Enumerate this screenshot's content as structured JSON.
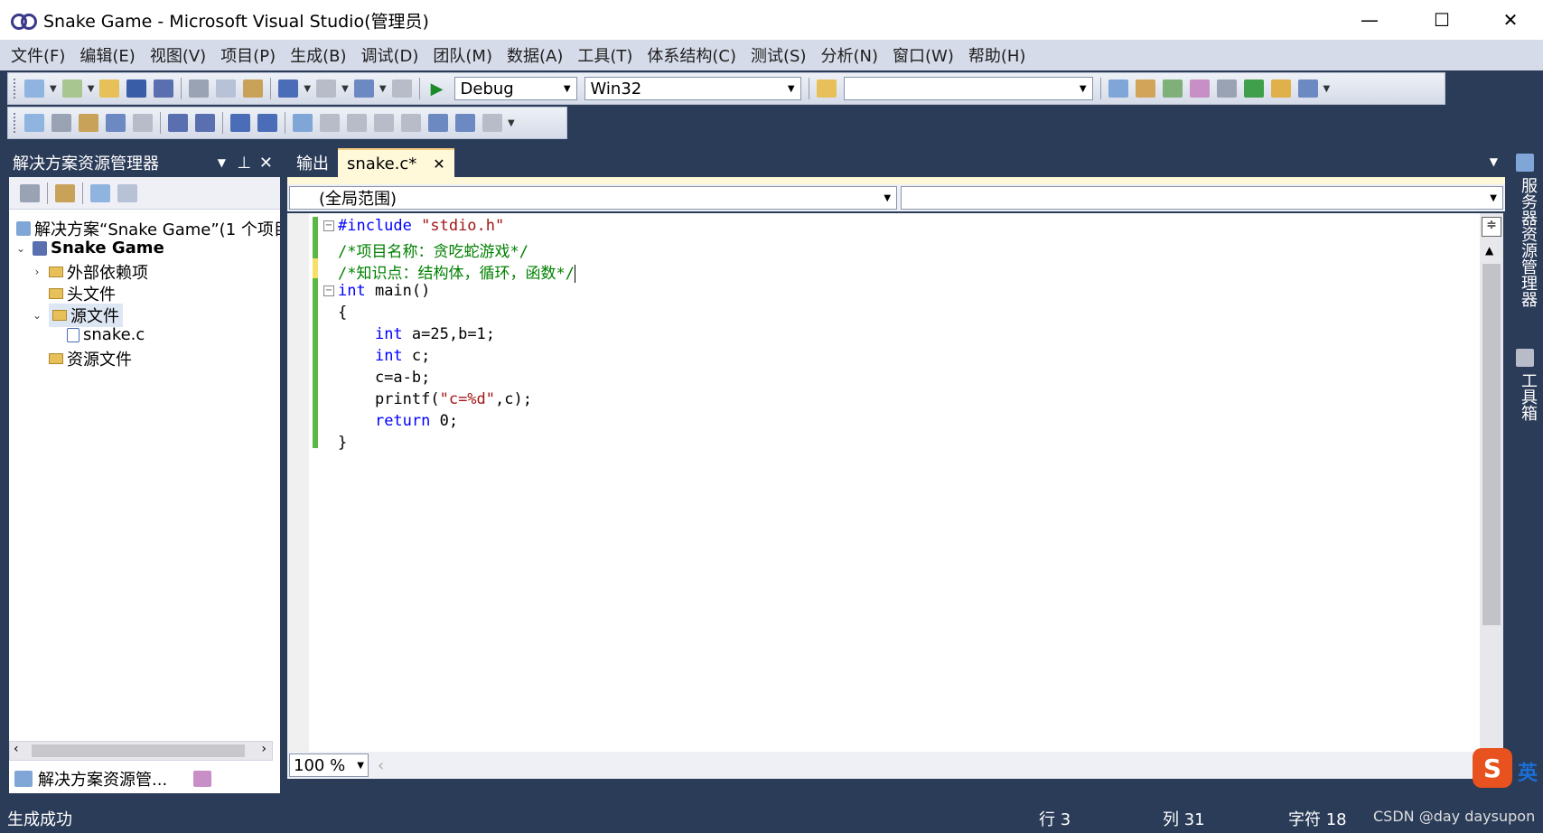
{
  "window": {
    "title": "Snake Game - Microsoft Visual Studio(管理员)",
    "min": "—",
    "max": "☐",
    "close": "✕"
  },
  "menu": [
    "文件(F)",
    "编辑(E)",
    "视图(V)",
    "项目(P)",
    "生成(B)",
    "调试(D)",
    "团队(M)",
    "数据(A)",
    "工具(T)",
    "体系结构(C)",
    "测试(S)",
    "分析(N)",
    "窗口(W)",
    "帮助(H)"
  ],
  "toolbar": {
    "config": "Debug",
    "platform": "Win32",
    "find": ""
  },
  "solution": {
    "header": "解决方案资源管理器",
    "root": "解决方案“Snake Game”(1 个项目",
    "project": "Snake Game",
    "deps": "外部依赖项",
    "headers": "头文件",
    "sources": "源文件",
    "file": "snake.c",
    "resources": "资源文件",
    "tab1": "解决方案资源管...",
    "tab2": "类视图"
  },
  "editor": {
    "tab_output": "输出",
    "tab_file": "snake.c*",
    "scope": "(全局范围)",
    "zoom": "100 %"
  },
  "code": [
    {
      "k": "",
      "a": "#include ",
      "s": "\"stdio.h\"",
      "r": ""
    },
    {
      "c": "/*项目名称：贪吃蛇游戏*/"
    },
    {
      "c": "/*知识点：结构体，循环，函数*/"
    },
    {
      "k": "int",
      "a": " main()"
    },
    {
      "a": "{"
    },
    {
      "a": "    ",
      "k": "int",
      "b": " a=25,b=1;"
    },
    {
      "a": "    ",
      "k": "int",
      "b": " c;"
    },
    {
      "a": "    c=a-b;"
    },
    {
      "a": "    printf(",
      "s": "\"c=%d\"",
      "b": ",c);"
    },
    {
      "a": "    ",
      "k": "return",
      "b": " 0;"
    },
    {
      "a": "}"
    }
  ],
  "side": {
    "server": "服务器资源管理器",
    "toolbox": "工具箱"
  },
  "status": {
    "msg": "生成成功",
    "line": "行 3",
    "col": "列 31",
    "ch": "字符 18",
    "watermark": "CSDN @day daysupon",
    "ime": "英"
  }
}
